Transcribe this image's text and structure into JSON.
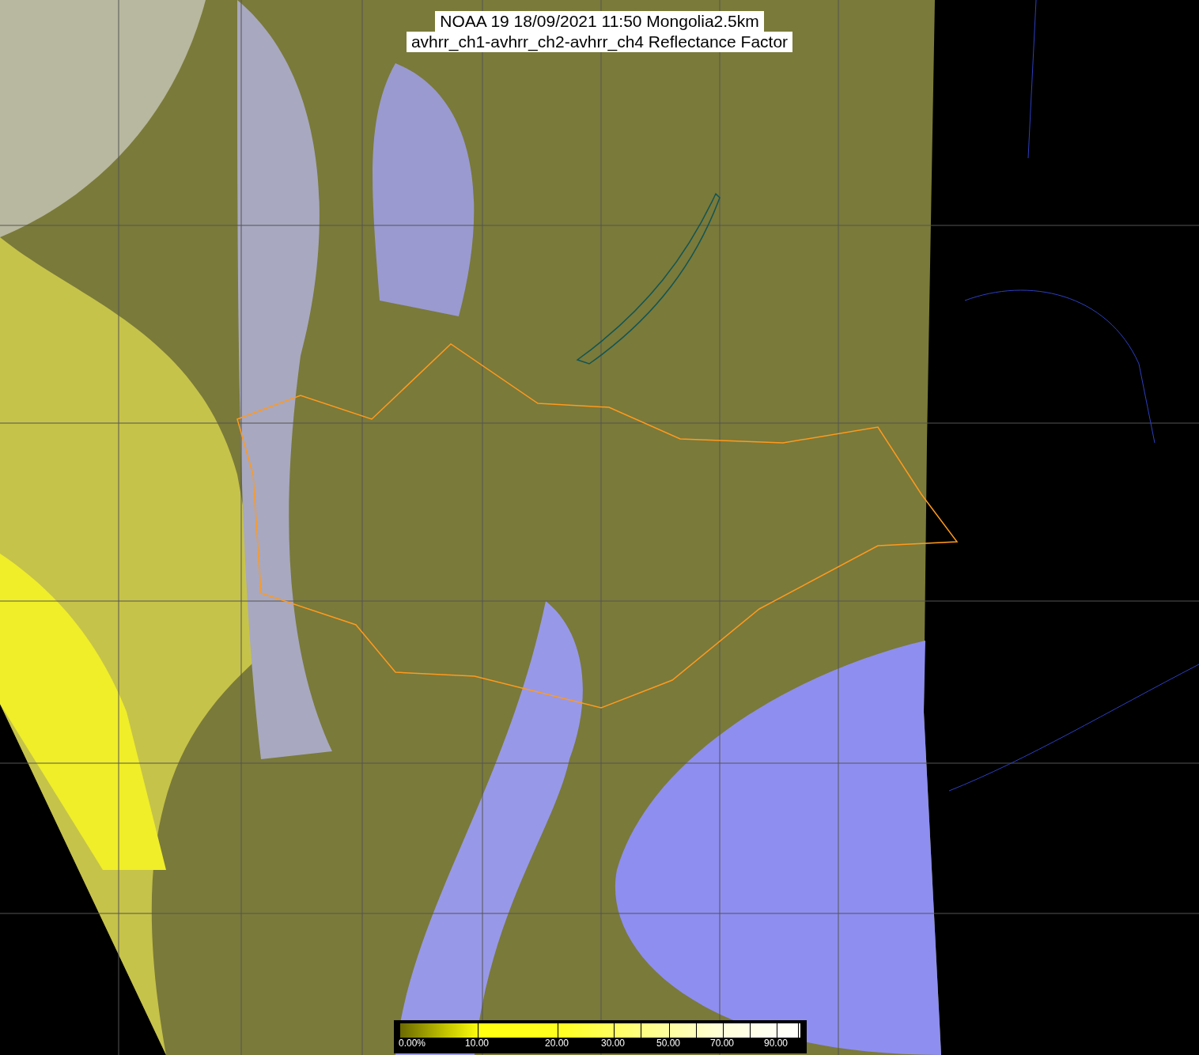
{
  "title": {
    "lines": [
      "NOAA 19 18/09/2021 11:50 Mongolia2.5km",
      "avhrr_ch1-avhrr_ch2-avhrr_ch4 Reflectance Factor"
    ]
  },
  "colorbar": {
    "labels": [
      "0.00%",
      "10.00",
      "20.00",
      "30.00",
      "50.00",
      "70.00",
      "90.00"
    ]
  }
}
